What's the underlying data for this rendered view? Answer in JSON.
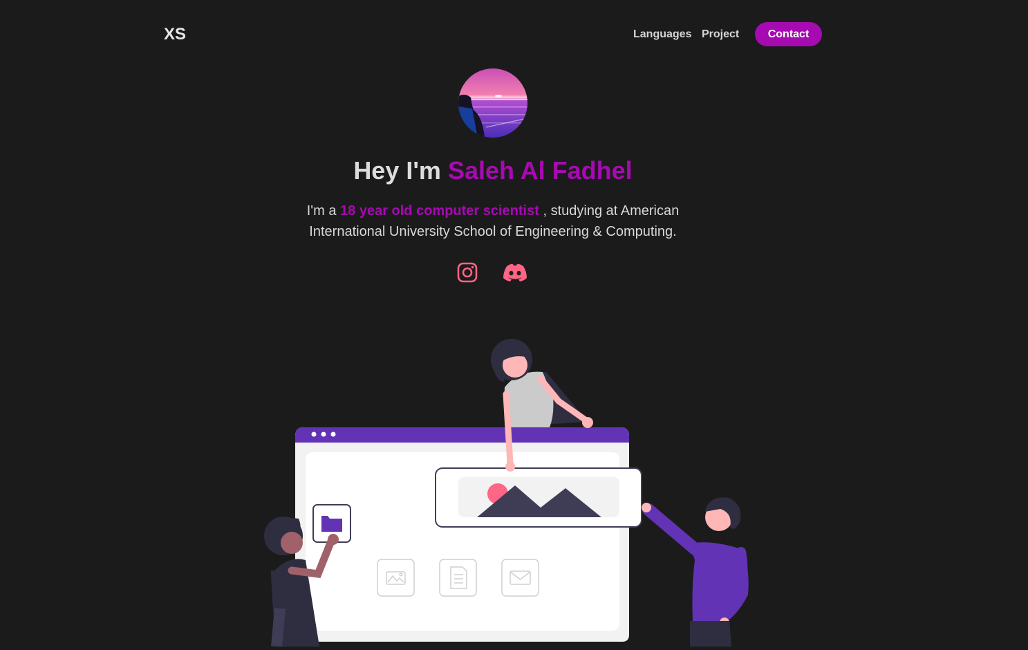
{
  "nav": {
    "logo": "XS",
    "links": [
      {
        "label": "Languages"
      },
      {
        "label": "Project"
      }
    ],
    "contact_label": "Contact"
  },
  "hero": {
    "greeting": "Hey I'm",
    "name": "Saleh Al Fadhel",
    "intro_prefix": "I'm a",
    "intro_highlight": "18 year old computer scientist",
    "intro_suffix": ", studying at American International University School of Engineering & Computing."
  },
  "social": [
    {
      "icon": "instagram-icon"
    },
    {
      "icon": "discord-icon"
    }
  ],
  "colors": {
    "background": "#1c1b1c",
    "accent": "#a60ab1",
    "social_icon": "#ff6584",
    "illustration_purple": "#6233b5"
  }
}
